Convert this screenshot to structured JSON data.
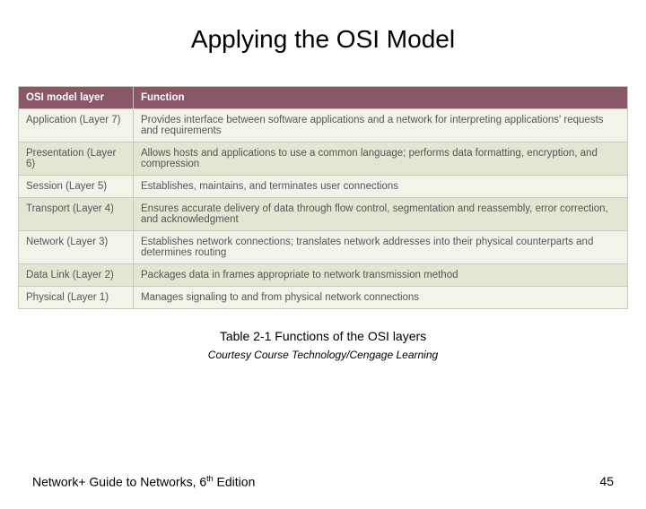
{
  "title": "Applying the OSI Model",
  "headers": {
    "layer": "OSI model layer",
    "function": "Function"
  },
  "rows": [
    {
      "layer": "Application (Layer 7)",
      "function": "Provides interface between software applications and a network for interpreting applications' requests and requirements"
    },
    {
      "layer": "Presentation (Layer 6)",
      "function": "Allows hosts and applications to use a common language; performs data formatting, encryption, and compression"
    },
    {
      "layer": "Session (Layer 5)",
      "function": "Establishes, maintains, and terminates user connections"
    },
    {
      "layer": "Transport (Layer 4)",
      "function": "Ensures accurate delivery of data through flow control, segmentation and reassembly, error correction, and acknowledgment"
    },
    {
      "layer": "Network (Layer 3)",
      "function": "Establishes network connections; translates network addresses into their physical counterparts and determines routing"
    },
    {
      "layer": "Data Link (Layer 2)",
      "function": "Packages data in frames appropriate to network transmission method"
    },
    {
      "layer": "Physical (Layer 1)",
      "function": "Manages signaling to and from physical network connections"
    }
  ],
  "caption": "Table 2-1 Functions of the OSI layers",
  "courtesy": "Courtesy Course Technology/Cengage Learning",
  "footer": {
    "book_prefix": "Network+ Guide to Networks, 6",
    "book_suffix": " Edition",
    "ordinal": "th",
    "page": "45"
  }
}
